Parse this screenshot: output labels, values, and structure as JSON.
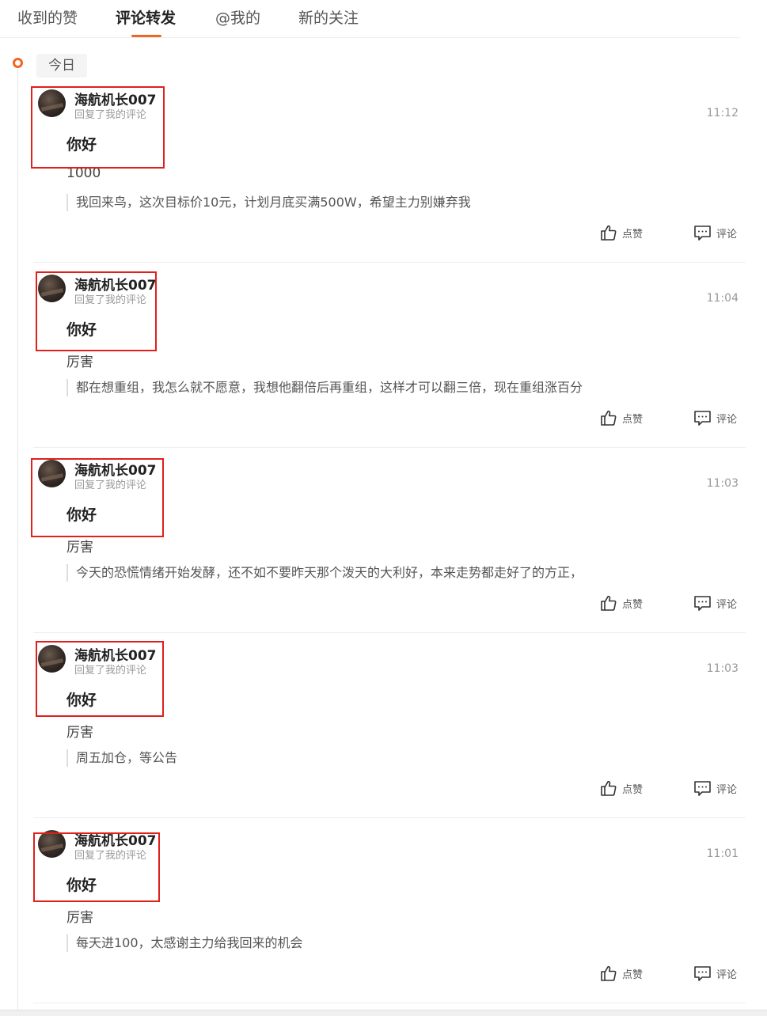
{
  "tabs": [
    {
      "label": "收到的赞"
    },
    {
      "label": "评论转发"
    },
    {
      "label": "@我的"
    },
    {
      "label": "新的关注"
    }
  ],
  "active_tab": "评论转发",
  "accent_color": "#f26522",
  "highlight_color": "#e0201b",
  "date_label": "今日",
  "like_label": "点赞",
  "comment_label": "评论",
  "items": [
    {
      "user": "海航机长007",
      "action": "回复了我的评论",
      "time": "11:12",
      "reply": "你好",
      "original": "1000",
      "quote": "我回来鸟，这次目标价10元，计划月底买满500W，希望主力别嫌弃我"
    },
    {
      "user": "海航机长007",
      "action": "回复了我的评论",
      "time": "11:04",
      "reply": "你好",
      "original": "厉害",
      "quote": "都在想重组，我怎么就不愿意，我想他翻倍后再重组，这样才可以翻三倍，现在重组涨百分"
    },
    {
      "user": "海航机长007",
      "action": "回复了我的评论",
      "time": "11:03",
      "reply": "你好",
      "original": "厉害",
      "quote": "今天的恐慌情绪开始发酵，还不如不要昨天那个泼天的大利好，本来走势都走好了的方正，"
    },
    {
      "user": "海航机长007",
      "action": "回复了我的评论",
      "time": "11:03",
      "reply": "你好",
      "original": "厉害",
      "quote": "周五加仓，等公告"
    },
    {
      "user": "海航机长007",
      "action": "回复了我的评论",
      "time": "11:01",
      "reply": "你好",
      "original": "厉害",
      "quote": "每天进100，太感谢主力给我回来的机会"
    }
  ]
}
